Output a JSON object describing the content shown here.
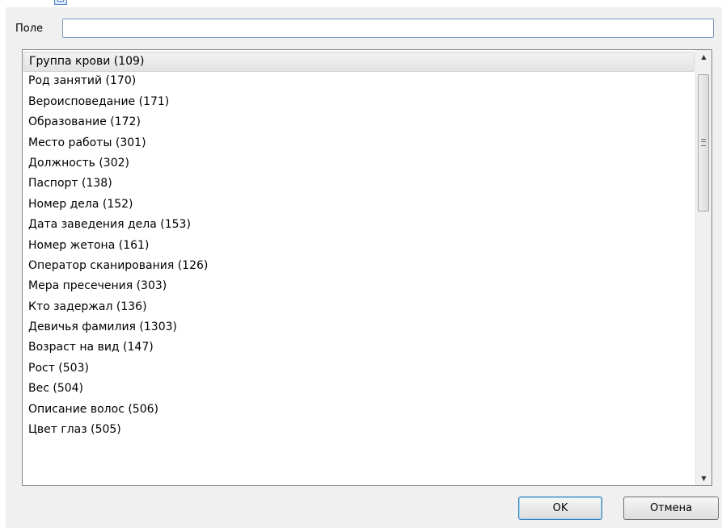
{
  "field": {
    "label": "Поле",
    "value": "",
    "placeholder": ""
  },
  "list": {
    "items": [
      "Группа крови (109)",
      "Род занятий (170)",
      "Вероисповедание (171)",
      "Образование (172)",
      "Место работы (301)",
      "Должность (302)",
      "Паспорт (138)",
      "Номер дела (152)",
      "Дата заведения дела (153)",
      "Номер жетона (161)",
      "Оператор сканирования (126)",
      "Мера пресечения (303)",
      "Кто задержал (136)",
      "Девичья фамилия (1303)",
      "Возраст на вид (147)",
      "Рост (503)",
      "Вес (504)",
      "Описание волос (506)",
      "Цвет глаз (505)",
      ""
    ],
    "selected_index": 0
  },
  "buttons": {
    "ok": "OK",
    "cancel": "Отмена"
  },
  "icons": {
    "title": "window-icon",
    "scroll_up": "up-arrow-icon",
    "scroll_down": "down-arrow-icon",
    "scroll_grip": "grip-icon"
  },
  "colors": {
    "input_border": "#7a9cc3",
    "ok_border": "#3c7fb1"
  }
}
